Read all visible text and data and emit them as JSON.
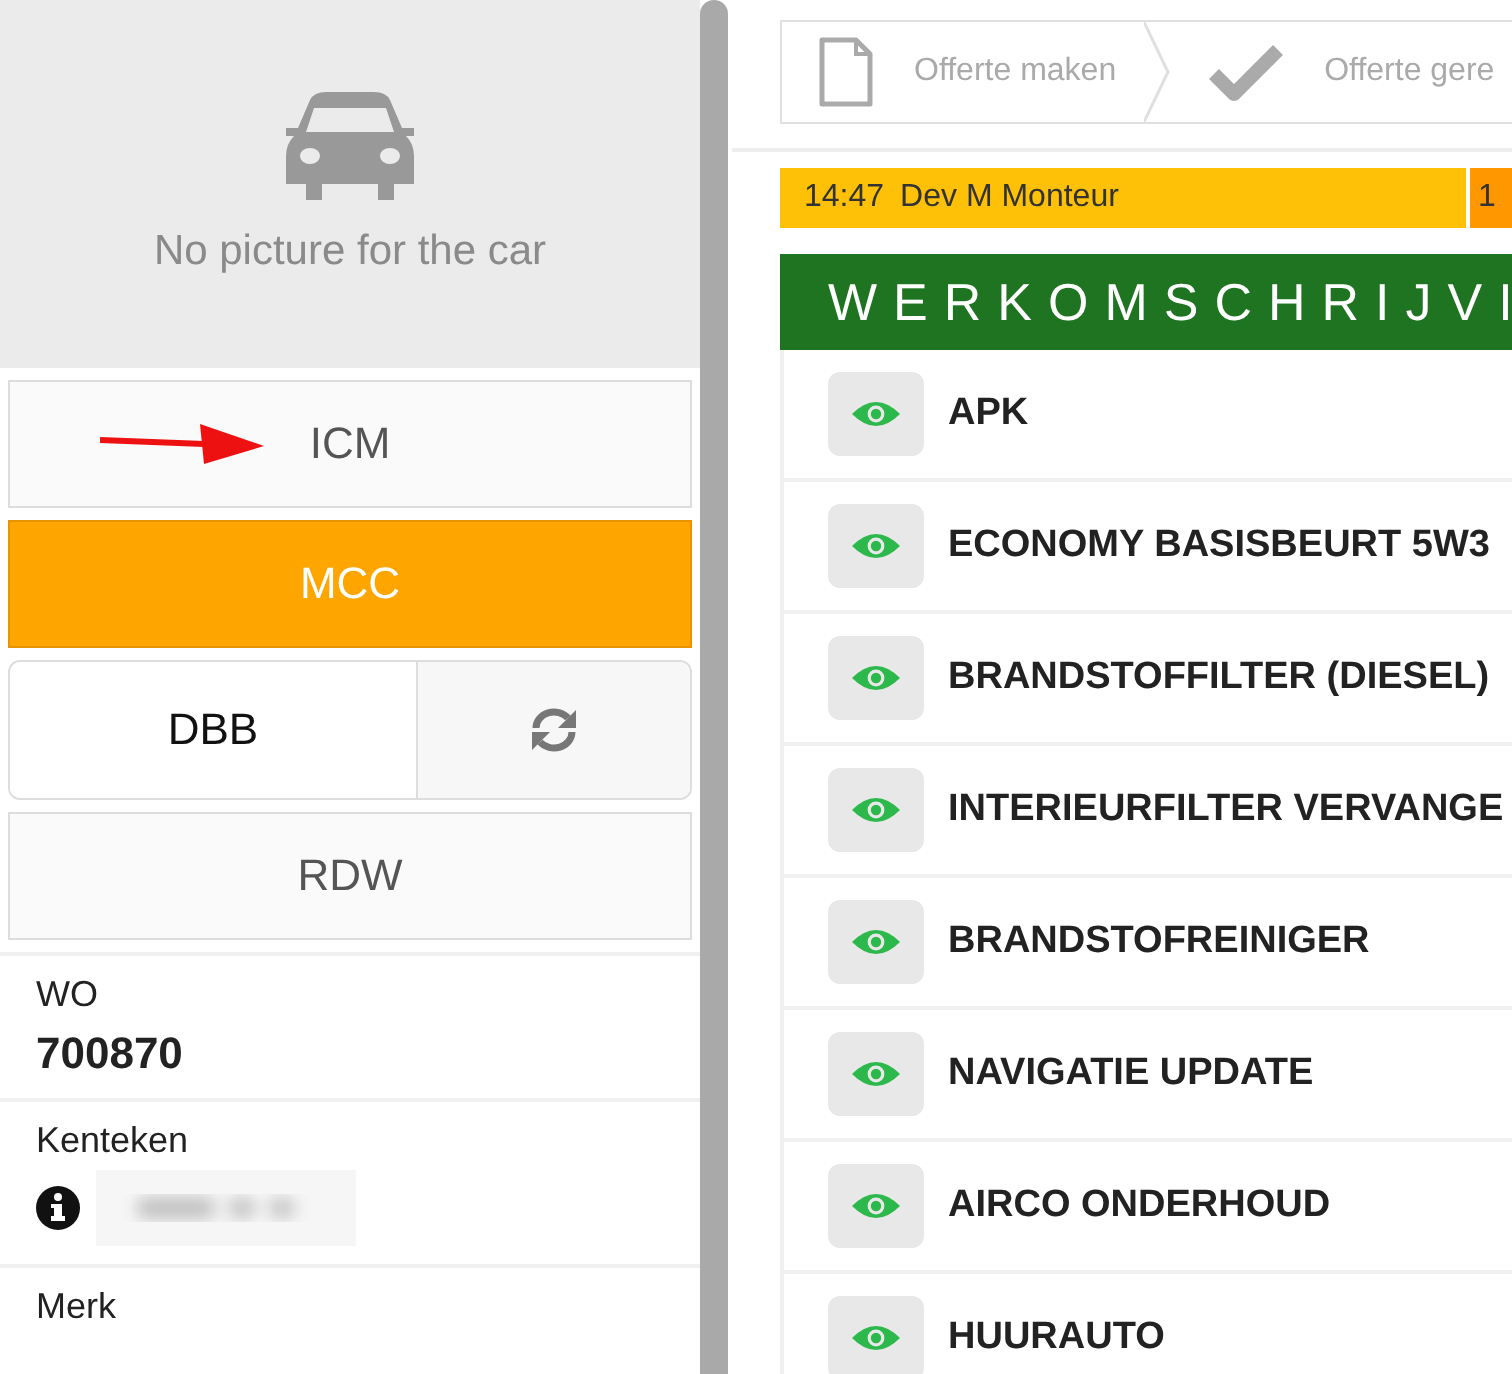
{
  "car_photo": {
    "caption": "No picture for the car"
  },
  "source_buttons": [
    {
      "kind": "wide",
      "label": "ICM",
      "selected": false,
      "annotated": true
    },
    {
      "kind": "wide",
      "label": "MCC",
      "selected": true,
      "annotated": false
    },
    {
      "kind": "split",
      "label": "DBB",
      "selected": false,
      "annotated": false
    },
    {
      "kind": "wide",
      "label": "RDW",
      "selected": false,
      "annotated": false
    }
  ],
  "fields": [
    {
      "kind": "value",
      "label": "WO",
      "value": "700870"
    },
    {
      "kind": "blurred",
      "label": "Kenteken"
    },
    {
      "kind": "label",
      "label": "Merk"
    }
  ],
  "steps": [
    {
      "label": "Offerte maken",
      "kind": "document"
    },
    {
      "label": "Offerte gere",
      "kind": "check"
    }
  ],
  "planning": [
    {
      "time": "14:47",
      "name": "Dev M Monteur",
      "color": "#ffc107"
    },
    {
      "time": "1",
      "color": "#ff9800"
    }
  ],
  "work_header": "WERKOMSCHRIJVI",
  "work_items": [
    {
      "title": "APK"
    },
    {
      "title": "ECONOMY BASISBEURT 5W3"
    },
    {
      "title": "BRANDSTOFFILTER (DIESEL)"
    },
    {
      "title": "INTERIEURFILTER VERVANGE"
    },
    {
      "title": "BRANDSTOFREINIGER"
    },
    {
      "title": "NAVIGATIE UPDATE"
    },
    {
      "title": "AIRCO ONDERHOUD"
    },
    {
      "title": "HUURAUTO"
    }
  ]
}
